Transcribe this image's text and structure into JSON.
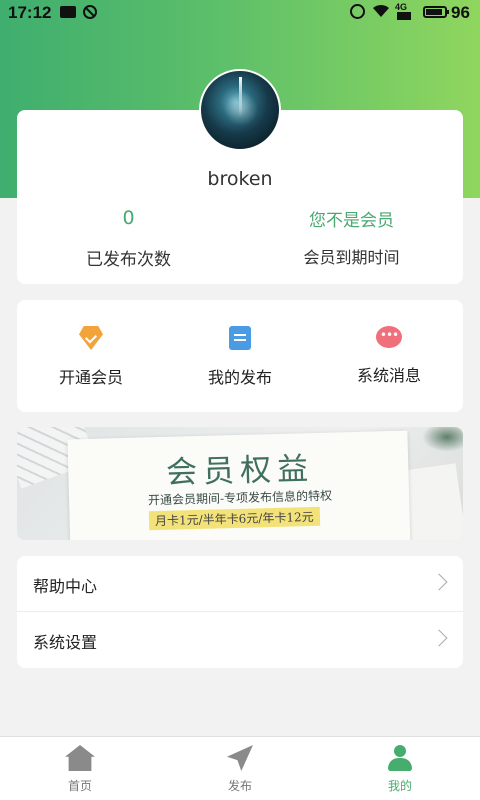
{
  "status_bar": {
    "time": "17:12",
    "net": "4G",
    "battery": "96"
  },
  "profile": {
    "username": "broken",
    "publish_count": "0",
    "publish_count_label": "已发布次数",
    "member_status": "您不是会员",
    "member_expiry_label": "会员到期时间"
  },
  "quick_actions": [
    {
      "label": "开通会员",
      "icon": "diamond-icon"
    },
    {
      "label": "我的发布",
      "icon": "document-icon"
    },
    {
      "label": "系统消息",
      "icon": "message-icon"
    }
  ],
  "banner": {
    "title": "会员权益",
    "subtitle": "开通会员期间-专项发布信息的特权",
    "price": "月卡1元/半年卡6元/年卡12元"
  },
  "menu": [
    {
      "label": "帮助中心"
    },
    {
      "label": "系统设置"
    }
  ],
  "tabbar": {
    "tabs": [
      {
        "label": "首页",
        "icon": "home-icon"
      },
      {
        "label": "发布",
        "icon": "send-icon"
      },
      {
        "label": "我的",
        "icon": "user-icon"
      }
    ],
    "active_index": 2
  },
  "colors": {
    "accent": "#47ad6f",
    "hero_start": "#3fae6e",
    "hero_end": "#8fd65e"
  }
}
